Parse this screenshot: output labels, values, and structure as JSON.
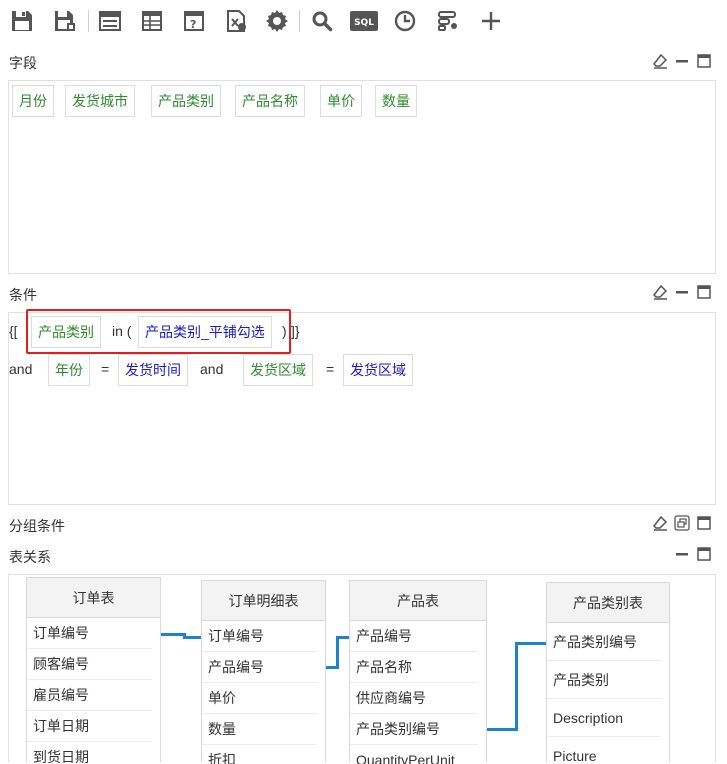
{
  "toolbar": {
    "icons": [
      "save-icon",
      "save-as-icon",
      "grid-layout-icon",
      "table-icon",
      "formula-icon",
      "export-icon",
      "gear-icon",
      "search-icon",
      "sql-icon",
      "clock-icon",
      "filter-settings-icon",
      "plus-icon"
    ],
    "sql_label": "SQL"
  },
  "fields": {
    "title": "字段",
    "items": [
      "月份",
      "发货城市",
      "产品类别",
      "产品名称",
      "单价",
      "数量"
    ]
  },
  "conditions": {
    "title": "条件",
    "open_bracket": "{[",
    "line1": {
      "field": "产品类别",
      "op": "in (",
      "value": "产品类别_平铺勾选",
      "close": ")",
      "tail": "]}"
    },
    "line2": {
      "and1": "and",
      "field1": "年份",
      "eq1": "=",
      "value1": "发货时间",
      "and2": "and",
      "field2": "发货区域",
      "eq2": "=",
      "value2": "发货区域"
    }
  },
  "group_conditions": {
    "title": "分组条件"
  },
  "relations": {
    "title": "表关系",
    "tables": [
      {
        "name": "订单表",
        "columns": [
          "订单编号",
          "顾客编号",
          "雇员编号",
          "订单日期",
          "到货日期"
        ]
      },
      {
        "name": "订单明细表",
        "columns": [
          "订单编号",
          "产品编号",
          "单价",
          "数量",
          "折扣"
        ]
      },
      {
        "name": "产品表",
        "columns": [
          "产品编号",
          "产品名称",
          "供应商编号",
          "产品类别编号",
          "QuantityPerUnit"
        ]
      },
      {
        "name": "产品类别表",
        "columns": [
          "产品类别编号",
          "产品类别",
          "Description",
          "Picture"
        ]
      }
    ]
  },
  "colors": {
    "link": "#1f7fd1",
    "field_text": "#2e8b2e",
    "param_text": "#1a1acc",
    "highlight": "#e02020"
  }
}
